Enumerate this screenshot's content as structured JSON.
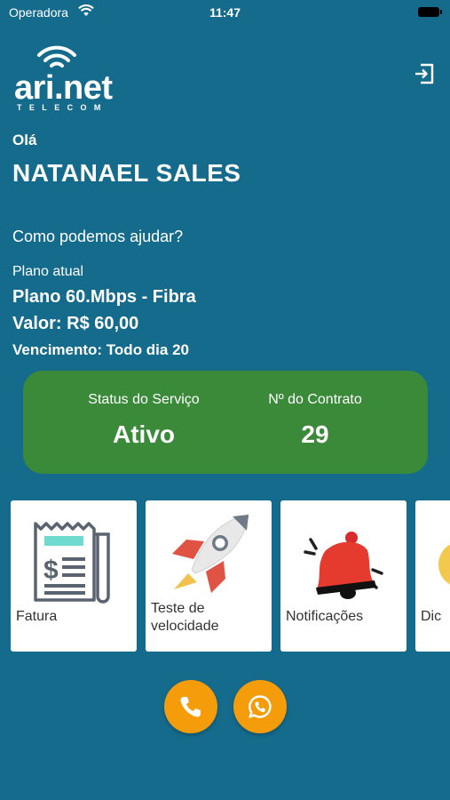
{
  "status_bar": {
    "carrier": "Operadora",
    "time": "11:47"
  },
  "logo": {
    "brand": "ari.net",
    "sub": "TELECOM"
  },
  "greeting": "Olá",
  "user": {
    "name": "NATANAEL SALES"
  },
  "help_text": "Como podemos ajudar?",
  "plan": {
    "label": "Plano atual",
    "name": "Plano 60.Mbps - Fibra",
    "value": "Valor: R$ 60,00",
    "due": "Vencimento: Todo dia 20"
  },
  "service": {
    "status_label": "Status do Serviço",
    "status_value": "Ativo",
    "contract_label": "Nº do Contrato",
    "contract_value": "29",
    "card_color": "#3a8a3a"
  },
  "tiles": [
    {
      "label": "Fatura",
      "icon": "invoice-icon"
    },
    {
      "label": "Teste de velocidade",
      "icon": "rocket-icon"
    },
    {
      "label": "Notificações",
      "icon": "bell-icon"
    },
    {
      "label": "Dic",
      "icon": "lightbulb-icon"
    }
  ],
  "actions": [
    {
      "icon": "phone-icon"
    },
    {
      "icon": "whatsapp-icon"
    }
  ],
  "colors": {
    "background": "#156b8c",
    "accent": "#f59c0b"
  }
}
